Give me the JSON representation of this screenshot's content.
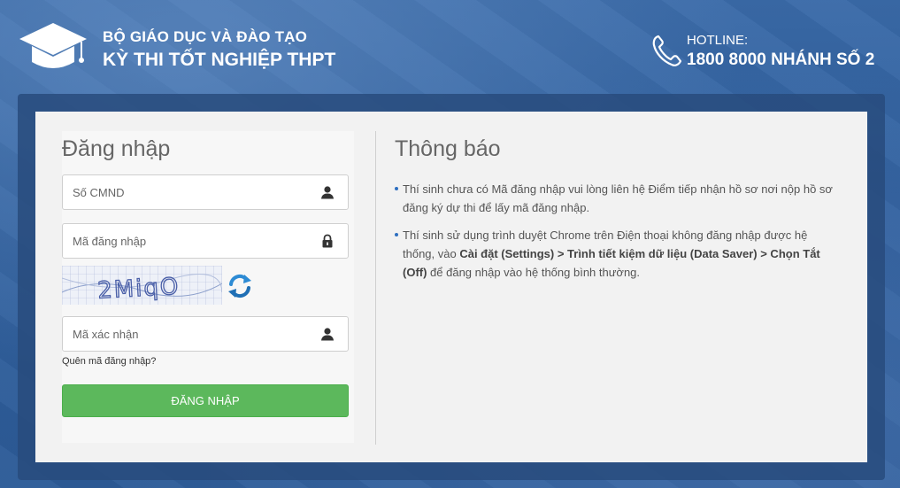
{
  "header": {
    "org": "BỘ GIÁO DỤC VÀ ĐÀO TẠO",
    "exam": "KỲ THI TỐT NGHIỆP THPT",
    "hotline_label": "HOTLINE:",
    "hotline_number": "1800 8000 NHÁNH SỐ 2"
  },
  "login": {
    "title": "Đăng nhập",
    "id_placeholder": "Số CMND",
    "code_placeholder": "Mã đăng nhập",
    "captcha_text": "2MiqO",
    "verify_placeholder": "Mã xác nhận",
    "forgot_label": "Quên mã đăng nhập?",
    "submit_label": "ĐĂNG NHẬP"
  },
  "notice": {
    "title": "Thông báo",
    "item1": "Thí sinh chưa có Mã đăng nhập vui lòng liên hệ Điểm tiếp nhận hồ sơ nơi nộp hồ sơ đăng ký dự thi để lấy mã đăng nhập.",
    "item2_prefix": "Thí sinh sử dụng trình duyệt Chrome trên Điện thoại không đăng nhập được hệ thống, vào ",
    "item2_bold": "Cài đặt (Settings) > Trình tiết kiệm dữ liệu (Data Saver) > Chọn Tắt (Off)",
    "item2_suffix": " để đăng nhập vào hệ thống bình thường."
  },
  "colors": {
    "background": "#2e5f9e",
    "card": "#f2f2f2",
    "primary_button": "#5cb85c",
    "bullet": "#2e6fc0"
  },
  "icons": {
    "logo": "graduation-cap-icon",
    "hotline": "phone-icon",
    "id_field": "user-icon",
    "code_field": "lock-icon",
    "verify_field": "user-icon",
    "captcha_refresh": "refresh-icon"
  }
}
